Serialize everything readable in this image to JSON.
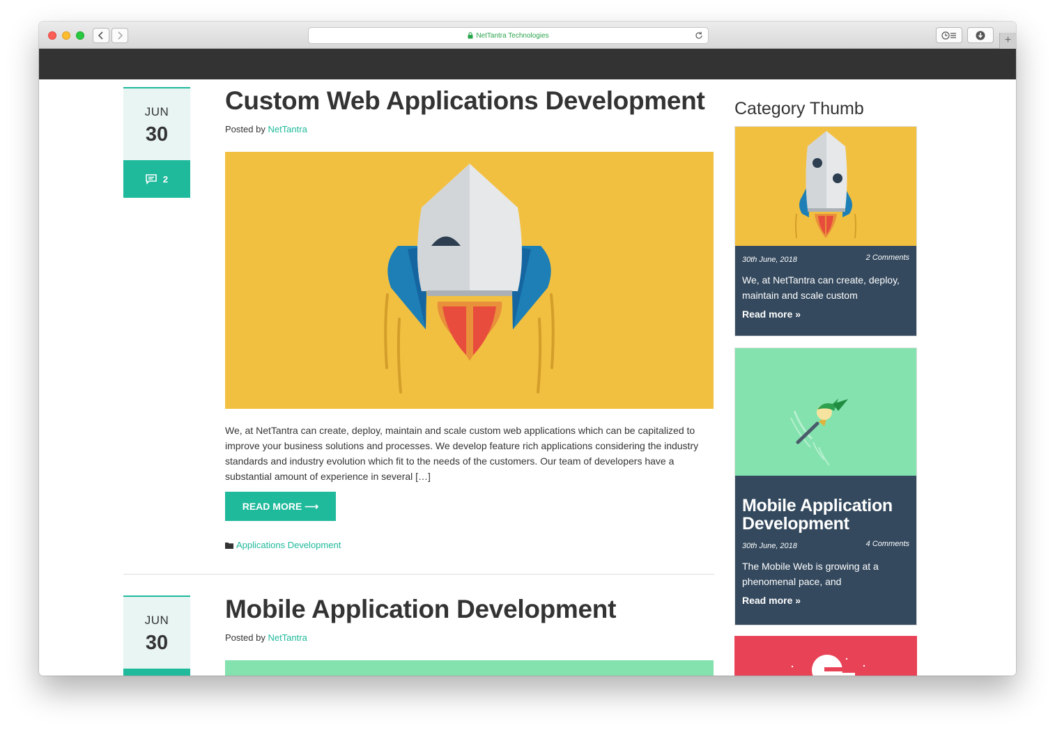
{
  "browser": {
    "url_text": "NetTantra Technologies"
  },
  "posts": [
    {
      "month": "JUN",
      "day": "30",
      "comment_count": "2",
      "title": "Custom Web Applications Development",
      "posted_by_label": "Posted by",
      "author": "NetTantra",
      "excerpt": "We, at NetTantra can create, deploy, maintain and scale custom web applications which can be capitalized to improve your business solutions and processes. We develop feature rich applications considering the industry standards and industry evolution which fit to the needs of the customers. Our team of developers have a substantial amount of experience in several […]",
      "read_more": "READ MORE ⟶",
      "category": "Applications Development"
    },
    {
      "month": "JUN",
      "day": "30",
      "title": "Mobile Application Development",
      "posted_by_label": "Posted by",
      "author": "NetTantra"
    }
  ],
  "sidebar": {
    "title": "Category Thumb",
    "cards": [
      {
        "date": "30th June, 2018",
        "comments": "2 Comments",
        "text": "We, at NetTantra can create, deploy, maintain and scale custom",
        "read_more": "Read more »"
      },
      {
        "title": "Mobile Application Development",
        "date": "30th June, 2018",
        "comments": "4 Comments",
        "text": "The Mobile Web is growing at a phenomenal pace, and",
        "read_more": "Read more »"
      }
    ]
  },
  "colors": {
    "accent": "#1fb99b",
    "hero_yellow": "#f2c041",
    "hero_green": "#83e2ad",
    "hero_red": "#e84256",
    "card_dark": "#34495e",
    "top_bar": "#333333"
  }
}
